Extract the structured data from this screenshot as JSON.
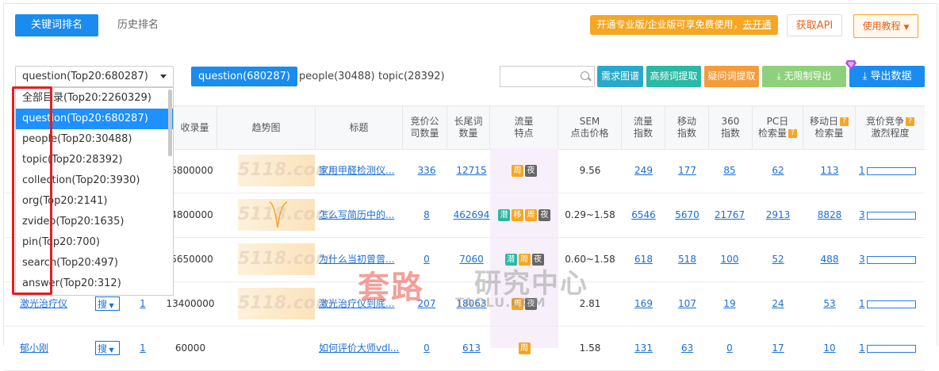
{
  "top_tabs": {
    "active": "关键词排名",
    "other": "历史排名"
  },
  "promo": {
    "text": "开通专业版/企业版可享免费使用，",
    "link": "去开通"
  },
  "api_button": "获取API",
  "tutorial_button": "使用教程",
  "category_select": {
    "value": "question(Top20:680287)"
  },
  "category_tabs": [
    "question(680287)",
    "people(30488)",
    "topic(28392)"
  ],
  "search": {
    "placeholder": ""
  },
  "tool_buttons": [
    "需求图谱",
    "高频词提取",
    "疑问词提取",
    "无限制导出",
    "导出数据"
  ],
  "dropdown_options": [
    "全部目录(Top20:2260329)",
    "question(Top20:680287)",
    "people(Top20:30488)",
    "topic(Top20:28392)",
    "collection(Top20:3930)",
    "org(Top20:2141)",
    "zvideo(Top20:1635)",
    "pin(Top20:700)",
    "search(Top20:497)",
    "answer(Top20:312)"
  ],
  "columns": [
    "收录量",
    "趋势图",
    "标题",
    "竞价公司数量",
    "长尾词数量",
    "流量特点",
    "SEM点击价格",
    "流量指数",
    "移动指数",
    "360指数",
    "PC日检索量",
    "移动日检索量",
    "竞价竞争激烈程度"
  ],
  "column_lines": {
    "bid_companies": [
      "竞价公",
      "司数量"
    ],
    "longtail": [
      "长尾词",
      "数量"
    ],
    "traffic": [
      "流量",
      "特点"
    ],
    "sem": [
      "SEM",
      "点击价格"
    ],
    "flow_index": [
      "流量",
      "指数"
    ],
    "mobile_index": [
      "移动",
      "指数"
    ],
    "index_360": [
      "360",
      "指数"
    ],
    "pc_daily": [
      "PC日",
      "检索量"
    ],
    "mobile_daily": [
      "移动日",
      "检索量"
    ],
    "competition": [
      "竞价竞争",
      "激烈程度"
    ]
  },
  "trend_watermark": "5118.com",
  "rows": [
    {
      "keyword": "",
      "rank": "",
      "indexed": "6800000",
      "title": "家用甲醛检测仪...",
      "bid": "336",
      "longtail": "12715",
      "tags": [
        "周",
        "夜"
      ],
      "sem": "9.56",
      "flow": "249",
      "mobile": "177",
      "i360": "85",
      "pc": "62",
      "mdaily": "113",
      "comp": "1"
    },
    {
      "keyword": "",
      "rank": "",
      "indexed": "4800000",
      "title": "怎么写简历中的...",
      "bid": "8",
      "longtail": "462694",
      "tags": [
        "潜",
        "移",
        "周",
        "夜"
      ],
      "sem": "0.29~1.58",
      "flow": "6546",
      "mobile": "5670",
      "i360": "21767",
      "pc": "2913",
      "mdaily": "8828",
      "comp": "3"
    },
    {
      "keyword": "",
      "rank": "",
      "indexed": "5650000",
      "title": "为什么当初曾曾...",
      "bid": "0",
      "longtail": "7060",
      "tags": [
        "潜",
        "周",
        "夜"
      ],
      "sem": "0.60~1.58",
      "flow": "618",
      "mobile": "518",
      "i360": "100",
      "pc": "52",
      "mdaily": "488",
      "comp": "3"
    },
    {
      "keyword": "激光治疗仪",
      "rank": "1",
      "indexed": "13400000",
      "title": "激光治疗仪到底...",
      "bid": "207",
      "longtail": "18063",
      "tags": [
        "周",
        "夜"
      ],
      "sem": "2.81",
      "flow": "169",
      "mobile": "107",
      "i360": "19",
      "pc": "24",
      "mdaily": "53",
      "comp": "1"
    },
    {
      "keyword": "郁小刚",
      "rank": "1",
      "indexed": "60000",
      "title": "如何评价大师vdl...",
      "bid": "0",
      "longtail": "613",
      "tags": [
        "周"
      ],
      "sem": "1.58",
      "flow": "131",
      "mobile": "63",
      "i360": "0",
      "pc": "17",
      "mdaily": "10",
      "comp": "1"
    }
  ],
  "search_engine_label": "搜",
  "watermark": {
    "cn": "套路",
    "cn2": "研究中心",
    "en": "TAOLU.COM"
  },
  "colors": {
    "primary": "#1a8cf0",
    "orange": "#f5a623",
    "teal": "#29b9a4",
    "green_light": "#8fd07c",
    "red_box": "#e02020"
  }
}
